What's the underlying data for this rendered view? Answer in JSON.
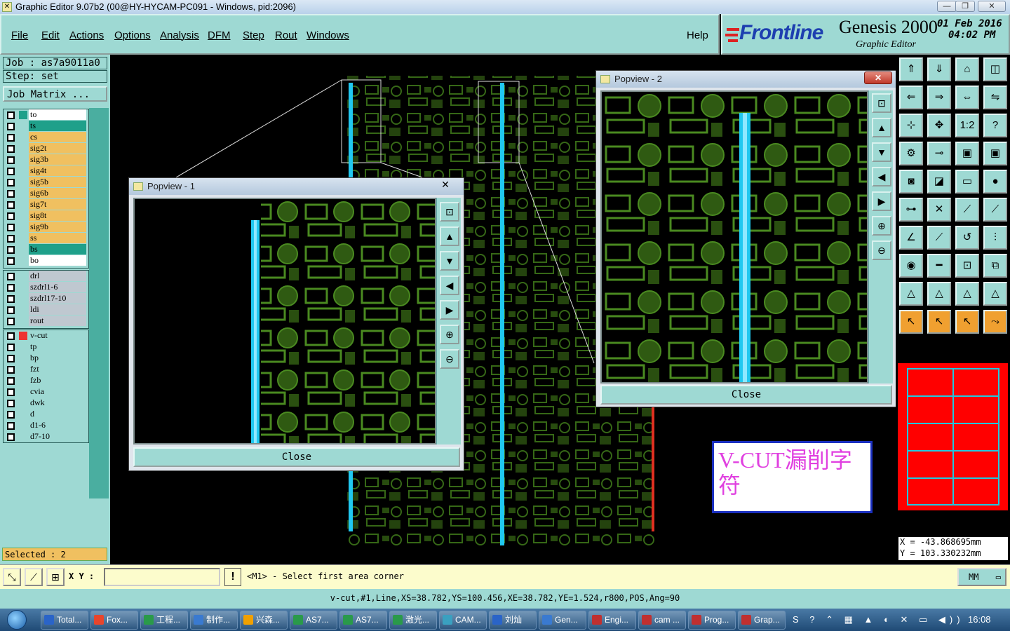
{
  "window": {
    "title": "Graphic Editor 9.07b2 (00@HY-HYCAM-PC091 - Windows, pid:2096)"
  },
  "menu": {
    "items": [
      "File",
      "Edit",
      "Actions",
      "Options",
      "Analysis",
      "DFM",
      "Step",
      "Rout",
      "Windows"
    ],
    "help": "Help"
  },
  "brand": {
    "logo": "Frontline",
    "product": "Genesis 2000",
    "subtitle": "Graphic Editor",
    "date": "01 Feb 2016",
    "time": "04:02 PM"
  },
  "job": {
    "job_label": "Job : as7a9011a0",
    "step_label": "Step: set",
    "matrix_button": "Job Matrix ..."
  },
  "layers_board": [
    "to",
    "ts",
    "cs",
    "sig2t",
    "sig3b",
    "sig4t",
    "sig5b",
    "sig6b",
    "sig7t",
    "sig8t",
    "sig9b",
    "ss",
    "bs",
    "bo"
  ],
  "layers_drill": [
    "drl",
    "szdrl1-6",
    "szdrl17-10",
    "ldi",
    "rout"
  ],
  "layers_misc": [
    "v-cut",
    "tp",
    "bp",
    "fzt",
    "fzb",
    "cvia",
    "dwk",
    "d",
    "d1-6",
    "d7-10"
  ],
  "selected_label": "Selected : 2",
  "popview1": {
    "title": "Popview - 1",
    "close": "Close"
  },
  "popview2": {
    "title": "Popview - 2",
    "close": "Close"
  },
  "annotation": {
    "text": "V-CUT漏削字符",
    "color": "#e040e0"
  },
  "coords": {
    "x": "X = -43.868695mm",
    "y": "Y = 103.330232mm"
  },
  "command": {
    "xy_label": "X Y :",
    "xy_value": "",
    "prompt": "<M1> - Select first area corner",
    "units": "MM"
  },
  "status_line": "v-cut,#1,Line,XS=38.782,YS=100.456,XE=38.782,YE=1.524,r800,POS,Ang=90",
  "taskbar": {
    "items": [
      "Total...",
      "Fox...",
      "工程...",
      "制作...",
      "兴森...",
      "AS7...",
      "AS7...",
      "激光...",
      "CAM...",
      "刘灿",
      "Gen...",
      "Engi...",
      "cam ...",
      "Prog...",
      "Grap..."
    ],
    "clock": "16:08"
  },
  "colors": {
    "panel": "#9ed9d3",
    "layer_board": "#f0c060",
    "layer_selected": "#1fa08a",
    "layer_drill": "#bfc8d0",
    "layer_misc": "#9ed9d3",
    "vcut_line": "#20c8f0",
    "pcb_green": "#4a8a20"
  }
}
